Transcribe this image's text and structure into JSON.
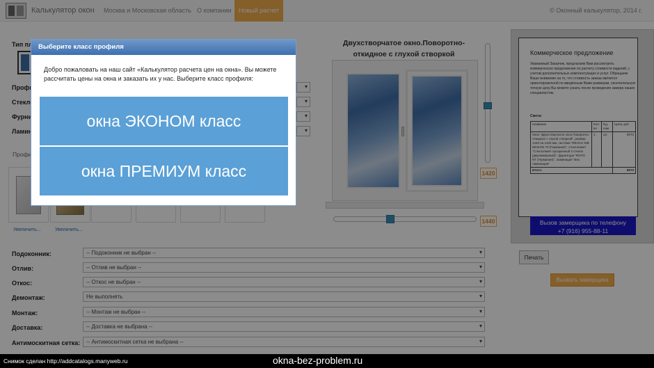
{
  "navbar": {
    "brand": "Калькулятор окон",
    "links": [
      "Москва и Московская область",
      "О компании"
    ],
    "active_link": "Новый расчет",
    "copyright": "© Оконный калькулятор, 2014 г."
  },
  "form": {
    "type_label": "Тип пл",
    "top_labels": [
      "Профил",
      "Стекло",
      "Фурнит",
      "Ламин"
    ],
    "profile_section_label": "Профи",
    "zoom_link": "Увеличить...",
    "fields": [
      {
        "label": "Подоконник:",
        "value": "-- Подоконник не выбран --"
      },
      {
        "label": "Отлив:",
        "value": "-- Отлив не выбран --"
      },
      {
        "label": "Откос:",
        "value": "-- Откос не выбран --"
      },
      {
        "label": "Демонтаж:",
        "value": "Не выполнять"
      },
      {
        "label": "Монтаж:",
        "value": "-- Монтаж не выбран --"
      },
      {
        "label": "Доставка:",
        "value": "-- Доставка не выбрана --"
      },
      {
        "label": "Антимоскитная сетка:",
        "value": "-- Антимоскитная сетка не выбрана --"
      }
    ]
  },
  "window": {
    "title": "Двухстворчатое окно.Поворотно-откидное с глухой створкой",
    "height_value": "1420",
    "width_value": "1440"
  },
  "offer": {
    "title": "Коммерческое предложение",
    "intro": "Уважаемый Заказчик, предлагаем Вам рассмотреть коммерческое предложение по расчету стоимости изделий, с учетом дополнительных комплектующих и услуг. Обращаем Ваше внимание на то, что стоимость заказа является ориентировочной по введённым Вами размерам, окончательную точную цену Вы можете узнать после проведения замера наших специалистом.",
    "smeta_label": "Смета:",
    "table": {
      "headers": [
        "Название",
        "Кол-во",
        "Ед. изм.",
        "Цена, руб"
      ],
      "row": {
        "name": "Окно \"Двухстворчатое окно.Поворотно-откидное с глухой створкой\", размер 1440 на 1420 мм, система \"REHAU SIB DESIGN 70 (Германия)\", стеклопакет \"Стеклопакет прозрачный 3 стекла (двухкамерный)\", фурнитура \"ROTO NT (Германия)\", ламинация \"Без ламинации\"",
        "qty": "1",
        "unit": "шт.",
        "price": "8073"
      },
      "total_label": "Итого:",
      "total_value": "8073"
    },
    "call_button": "Вызов замерщика по телефону",
    "phone": "+7 (916) 955-88-11",
    "print_button": "Печать",
    "measure_button": "Вызвать замерщика"
  },
  "modal": {
    "header": "Выберите класс профиля",
    "text": "Добро пожаловать на наш сайт «Калькулятор расчета цен на окна». Вы можете рассчитать цены на окна и заказать их у нас. Выберите класс профиля:",
    "option_economy": "окна ЭКОНОМ класс",
    "option_premium": "окна ПРЕМИУМ класс"
  },
  "banner": {
    "snapshot_text": "Снимок сделан http://addcatalogs.manyweb.ru",
    "site": "okna-bez-problem.ru"
  }
}
